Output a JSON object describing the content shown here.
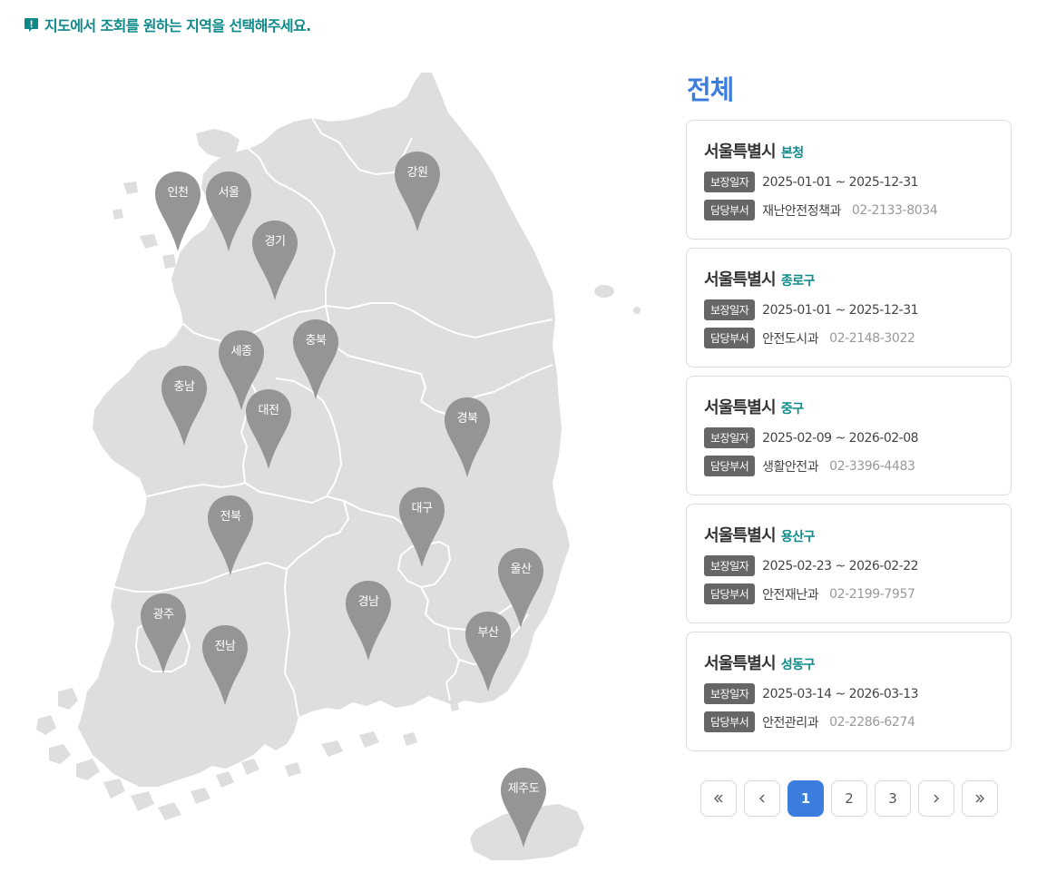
{
  "notice": {
    "icon": "exclamation-badge-icon",
    "text": "지도에서 조회를 원하는 지역을 선택해주세요.",
    "color": "#0f8a8a"
  },
  "map": {
    "pins": [
      {
        "id": "incheon",
        "label": "인천"
      },
      {
        "id": "seoul",
        "label": "서울"
      },
      {
        "id": "gangwon",
        "label": "강원"
      },
      {
        "id": "gyeonggi",
        "label": "경기"
      },
      {
        "id": "sejong",
        "label": "세종"
      },
      {
        "id": "chungbuk",
        "label": "충북"
      },
      {
        "id": "chungnam",
        "label": "충남"
      },
      {
        "id": "daejeon",
        "label": "대전"
      },
      {
        "id": "gyeongbuk",
        "label": "경북"
      },
      {
        "id": "jeonbuk",
        "label": "전북"
      },
      {
        "id": "daegu",
        "label": "대구"
      },
      {
        "id": "ulsan",
        "label": "울산"
      },
      {
        "id": "gwangju",
        "label": "광주"
      },
      {
        "id": "gyeongnam",
        "label": "경남"
      },
      {
        "id": "busan",
        "label": "부산"
      },
      {
        "id": "jeonnam",
        "label": "전남"
      },
      {
        "id": "jeju",
        "label": "제주도"
      }
    ],
    "pin_color": "#959595",
    "land_color": "#dedede"
  },
  "side": {
    "title": "전체",
    "title_color": "#3b7ddd",
    "period_tag": "보장일자",
    "dept_tag": "담당부서",
    "cards": [
      {
        "city": "서울특별시",
        "district": "본청",
        "period": "2025-01-01 ~ 2025-12-31",
        "dept": "재난안전정책과",
        "phone": "02-2133-8034"
      },
      {
        "city": "서울특별시",
        "district": "종로구",
        "period": "2025-01-01 ~ 2025-12-31",
        "dept": "안전도시과",
        "phone": "02-2148-3022"
      },
      {
        "city": "서울특별시",
        "district": "중구",
        "period": "2025-02-09 ~ 2026-02-08",
        "dept": "생활안전과",
        "phone": "02-3396-4483"
      },
      {
        "city": "서울특별시",
        "district": "용산구",
        "period": "2025-02-23 ~ 2026-02-22",
        "dept": "안전재난과",
        "phone": "02-2199-7957"
      },
      {
        "city": "서울특별시",
        "district": "성동구",
        "period": "2025-03-14 ~ 2026-03-13",
        "dept": "안전관리과",
        "phone": "02-2286-6274"
      }
    ]
  },
  "pagination": {
    "first_icon": "double-chevron-left-icon",
    "prev_icon": "chevron-left-icon",
    "next_icon": "chevron-right-icon",
    "last_icon": "double-chevron-right-icon",
    "pages": [
      "1",
      "2",
      "3"
    ],
    "current": "1",
    "active_color": "#3b7ddd"
  }
}
